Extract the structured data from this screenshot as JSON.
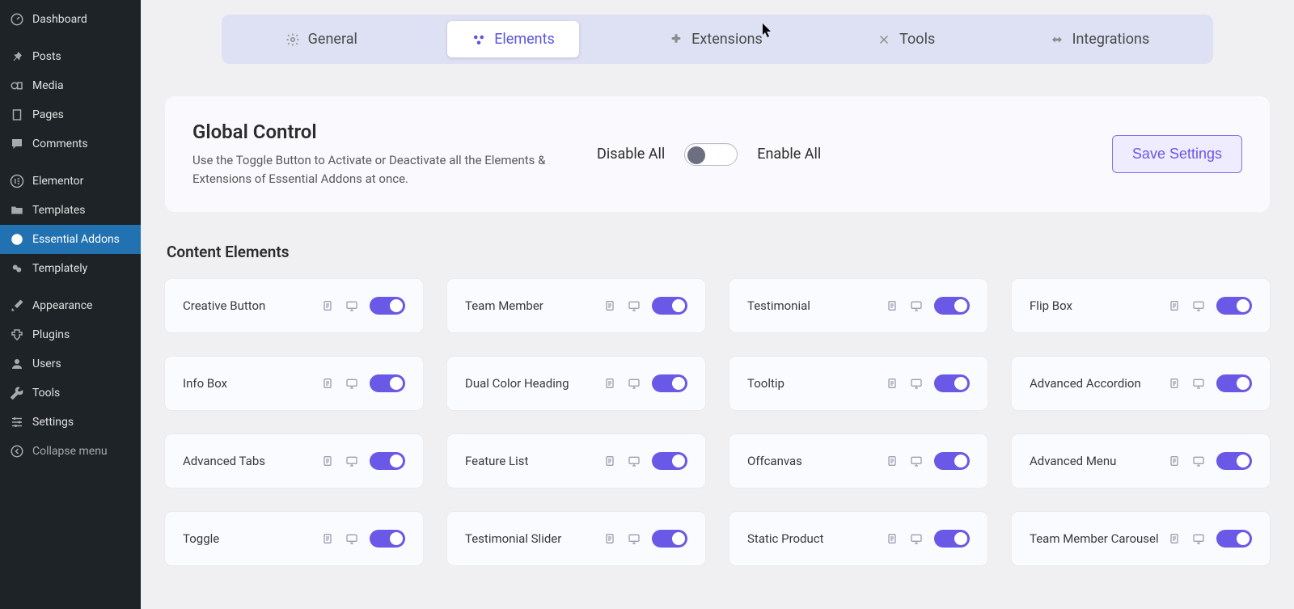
{
  "sidebar": {
    "items": [
      {
        "key": "dashboard",
        "label": "Dashboard"
      },
      {
        "key": "posts",
        "label": "Posts"
      },
      {
        "key": "media",
        "label": "Media"
      },
      {
        "key": "pages",
        "label": "Pages"
      },
      {
        "key": "comments",
        "label": "Comments"
      },
      {
        "key": "elementor",
        "label": "Elementor"
      },
      {
        "key": "templates",
        "label": "Templates"
      },
      {
        "key": "essential-addons",
        "label": "Essential Addons",
        "active": true
      },
      {
        "key": "templately",
        "label": "Templately"
      },
      {
        "key": "appearance",
        "label": "Appearance"
      },
      {
        "key": "plugins",
        "label": "Plugins"
      },
      {
        "key": "users",
        "label": "Users"
      },
      {
        "key": "tools",
        "label": "Tools"
      },
      {
        "key": "settings",
        "label": "Settings"
      }
    ],
    "collapse_label": "Collapse menu"
  },
  "tabs": {
    "general": "General",
    "elements": "Elements",
    "extensions": "Extensions",
    "tools": "Tools",
    "integrations": "Integrations",
    "active": "elements"
  },
  "global": {
    "title": "Global Control",
    "description": "Use the Toggle Button to Activate or Deactivate all the Elements & Extensions of Essential Addons at once.",
    "disable_label": "Disable All",
    "enable_label": "Enable All",
    "state": "off",
    "save_label": "Save Settings"
  },
  "section": {
    "title": "Content Elements"
  },
  "elements": [
    {
      "name": "Creative Button",
      "on": true
    },
    {
      "name": "Team Member",
      "on": true
    },
    {
      "name": "Testimonial",
      "on": true
    },
    {
      "name": "Flip Box",
      "on": true
    },
    {
      "name": "Info Box",
      "on": true
    },
    {
      "name": "Dual Color Heading",
      "on": true
    },
    {
      "name": "Tooltip",
      "on": true
    },
    {
      "name": "Advanced Accordion",
      "on": true
    },
    {
      "name": "Advanced Tabs",
      "on": true
    },
    {
      "name": "Feature List",
      "on": true
    },
    {
      "name": "Offcanvas",
      "on": true
    },
    {
      "name": "Advanced Menu",
      "on": true
    },
    {
      "name": "Toggle",
      "on": true
    },
    {
      "name": "Testimonial Slider",
      "on": true
    },
    {
      "name": "Static Product",
      "on": true
    },
    {
      "name": "Team Member Carousel",
      "on": true
    }
  ],
  "colors": {
    "accent": "#6a58e6",
    "tab_bg": "#dee1f4",
    "sidebar_bg": "#1d2327",
    "sidebar_active": "#2271b1"
  }
}
